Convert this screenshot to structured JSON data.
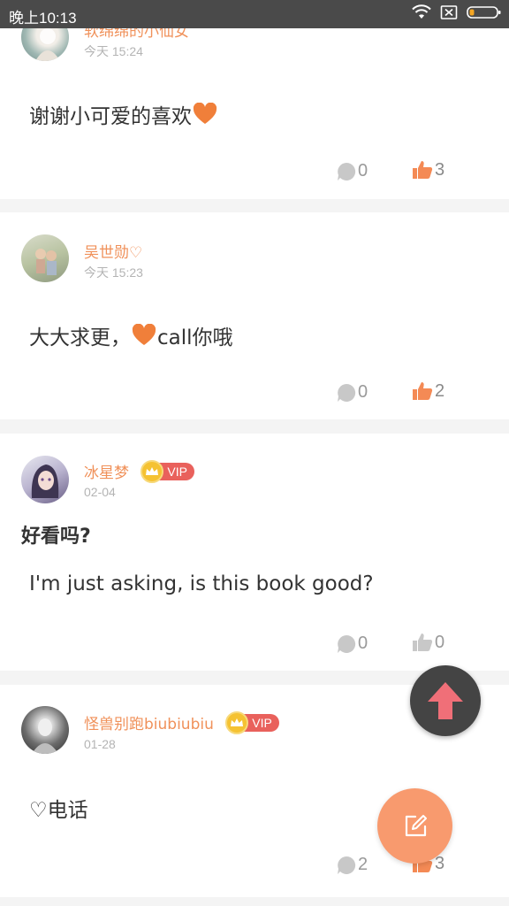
{
  "status_bar": {
    "time": "晚上10:13"
  },
  "colors": {
    "accent": "#f0915a",
    "like_active": "#f48a55",
    "heart": "#f07f3a",
    "fab_edit": "#f89a6e",
    "fab_top_arrow": "#f06f78"
  },
  "posts": [
    {
      "username": "软绵绵的小仙女",
      "date": "今天 15:24",
      "body_before": "谢谢小可爱的喜欢",
      "body_after": "",
      "comments": "0",
      "likes": "3",
      "liked": true
    },
    {
      "username": "吴世勋♡",
      "date": "今天 15:23",
      "body_before": "大大求更，",
      "body_after": "call你哦",
      "comments": "0",
      "likes": "2",
      "liked": true
    },
    {
      "username": "冰星梦",
      "vip": "VIP",
      "date": "02-04",
      "title": "好看吗?",
      "body_before": "I'm just asking, is this book good?",
      "comments": "0",
      "likes": "0",
      "liked": false
    },
    {
      "username": "怪兽别跑biubiubiu",
      "vip": "VIP",
      "date": "01-28",
      "body_before": "♡电话",
      "comments": "2",
      "likes": "3",
      "liked": true
    }
  ],
  "icons": {
    "comment": "comment-bubble-icon",
    "like": "thumbs-up-icon",
    "back_to_top": "arrow-up-icon",
    "write": "edit-icon"
  }
}
